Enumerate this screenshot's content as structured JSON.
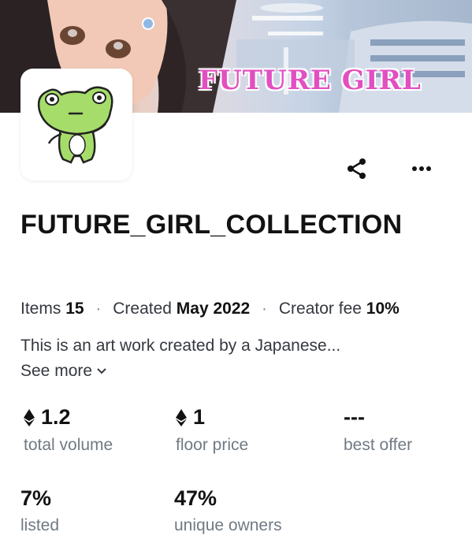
{
  "banner": {
    "title": "FUTURE GIRL"
  },
  "actions": {
    "share_icon": "share-icon",
    "more_icon": "more-dots-icon"
  },
  "collection": {
    "name": "FUTURE_GIRL_COLLECTION",
    "meta": {
      "items_label": "Items",
      "items_value": "15",
      "created_label": "Created",
      "created_value": "May 2022",
      "fee_label": "Creator fee",
      "fee_value": "10%"
    },
    "description": "This is an art work created by a Japanese...",
    "see_more": "See more"
  },
  "stats": [
    {
      "value": "1.2",
      "label": "total volume",
      "icon": "ethereum-icon"
    },
    {
      "value": "1",
      "label": "floor price",
      "icon": "ethereum-icon"
    },
    {
      "value": "---",
      "label": "best offer"
    },
    {
      "value": "7%",
      "label": "listed"
    },
    {
      "value": "47%",
      "label": "unique owners"
    }
  ],
  "colors": {
    "banner_title": "#e24fc1",
    "frog_green": "#a6dd6a",
    "label_gray": "#707a83"
  }
}
